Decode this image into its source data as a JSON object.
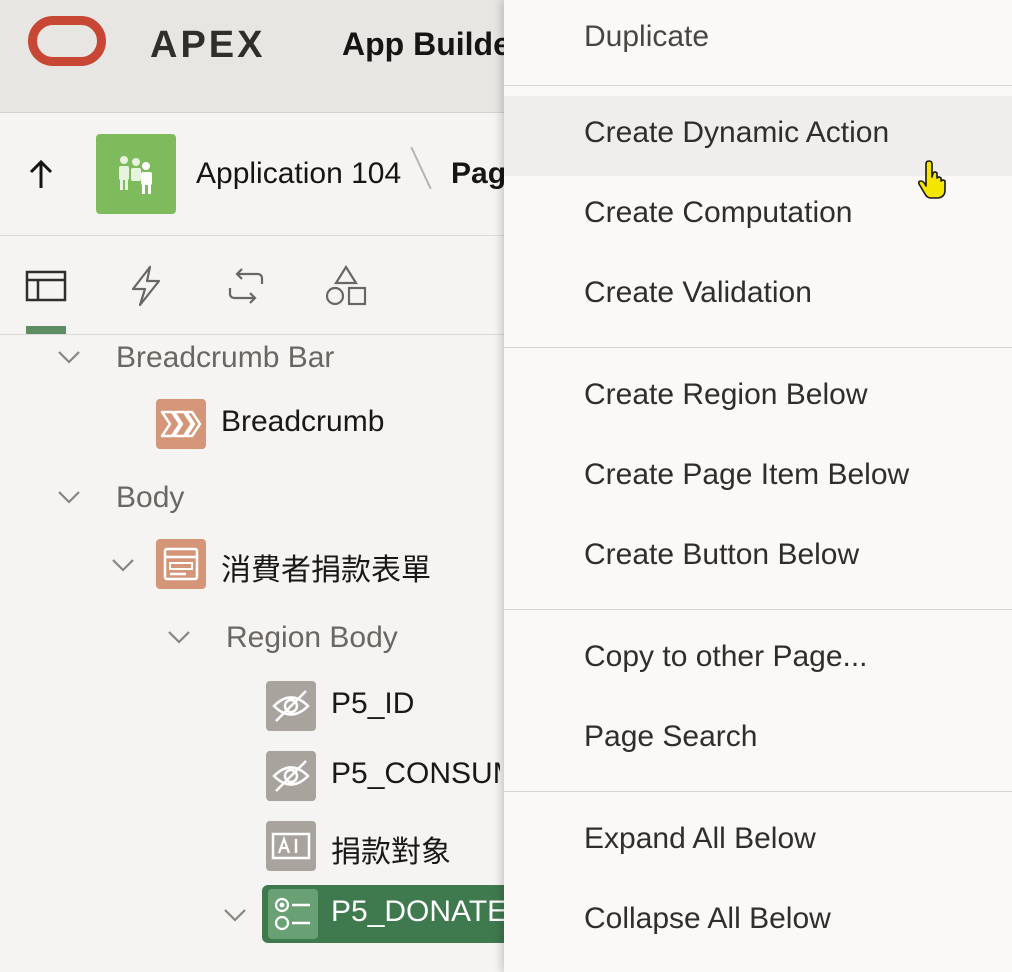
{
  "header": {
    "brand": "APEX",
    "title": "App Builde"
  },
  "breadcrumb": {
    "application": "Application 104",
    "page": "Pag"
  },
  "tabs": [
    {
      "name": "rendering",
      "icon": "layout-icon"
    },
    {
      "name": "dynamic-actions",
      "icon": "lightning-icon"
    },
    {
      "name": "processing",
      "icon": "refresh-icon"
    },
    {
      "name": "shared-components",
      "icon": "shapes-icon"
    }
  ],
  "tree": {
    "breadcrumb_bar": "Breadcrumb Bar",
    "breadcrumb": "Breadcrumb",
    "body": "Body",
    "form_region": "消費者捐款表單",
    "region_body": "Region Body",
    "item_id": "P5_ID",
    "item_consumer": "P5_CONSUM",
    "item_target": "捐款對象",
    "item_donate": "P5_DONATE_"
  },
  "menu": {
    "items": [
      "Duplicate",
      "Create Dynamic Action",
      "Create Computation",
      "Create Validation",
      "Create Region Below",
      "Create Page Item Below",
      "Create Button Below",
      "Copy to other Page...",
      "Page Search",
      "Expand All Below",
      "Collapse All Below"
    ],
    "hovered": "Create Dynamic Action"
  },
  "colors": {
    "oracle_red": "#c74634",
    "app_green": "#7dbb5c",
    "selected_green": "#3f7a4f",
    "region_salmon": "#d49579"
  }
}
